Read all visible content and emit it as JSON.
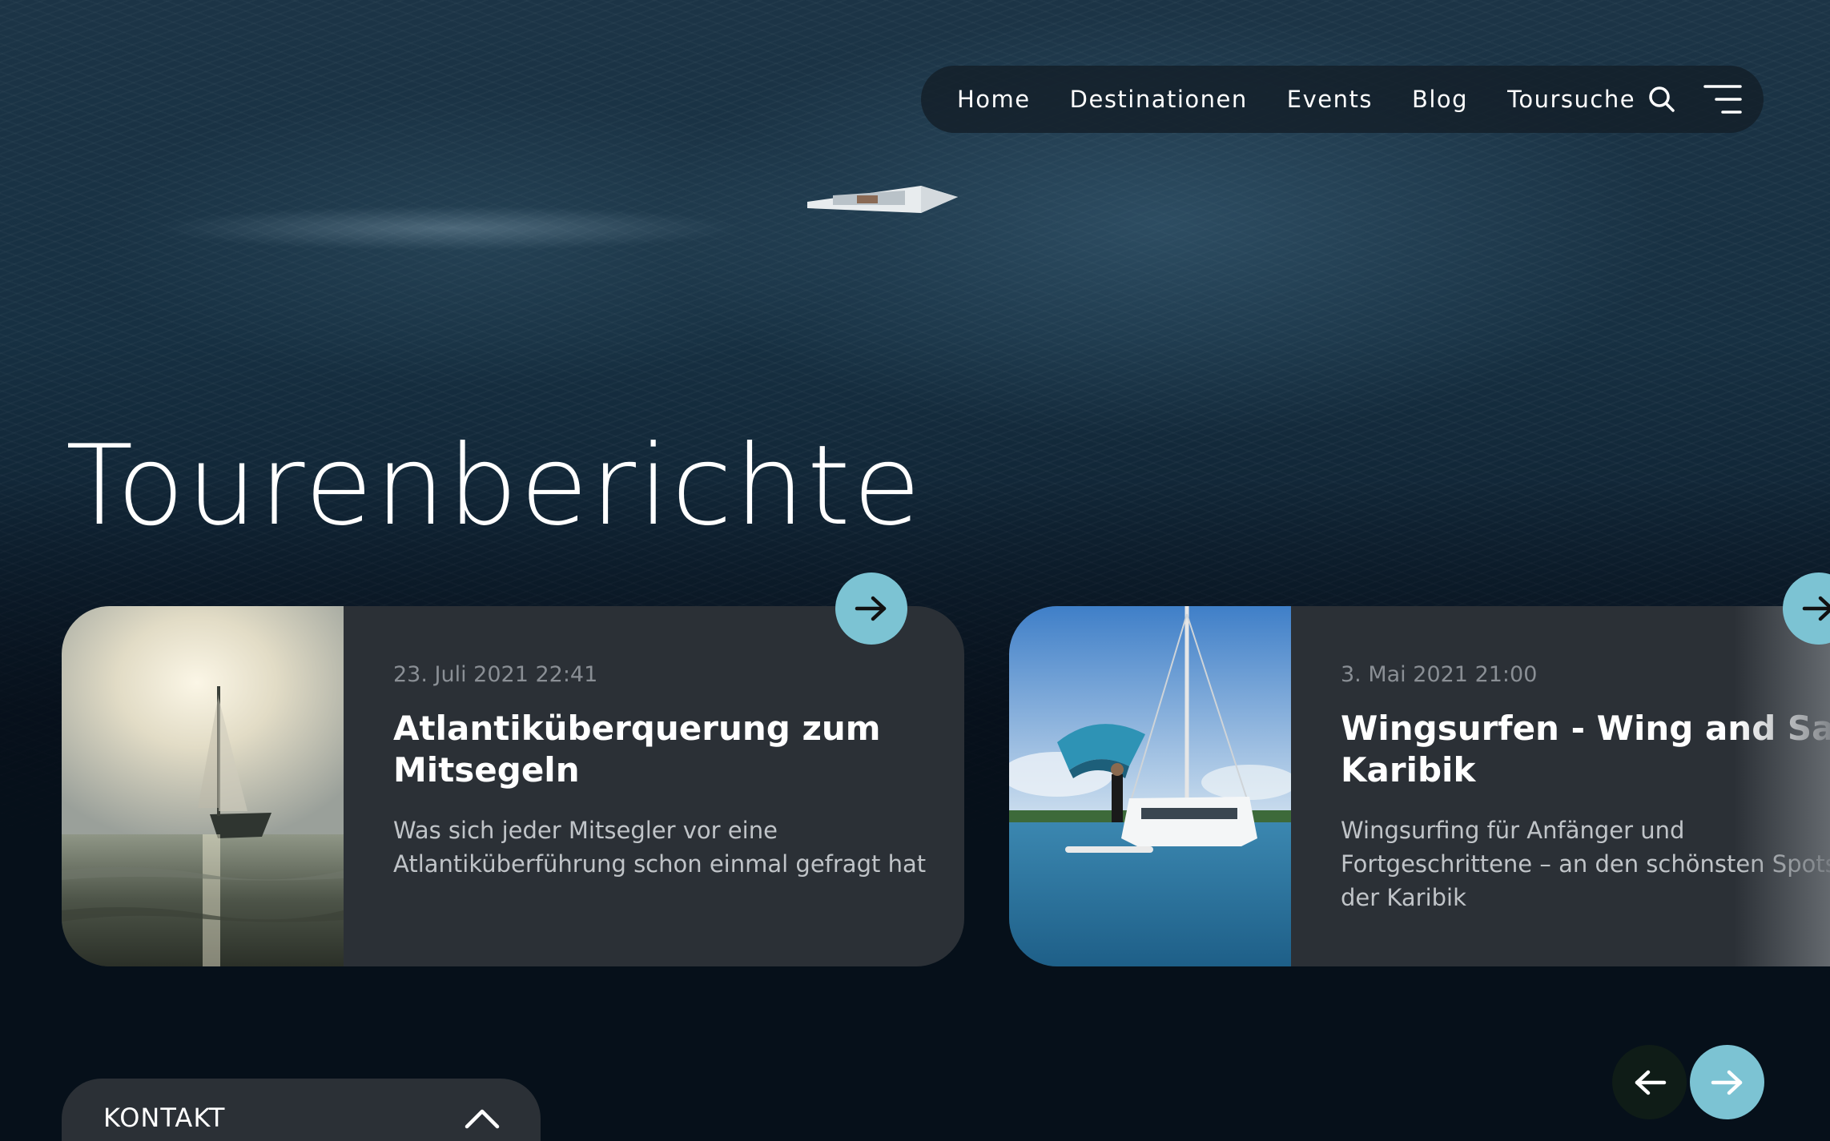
{
  "nav": {
    "items": [
      "Home",
      "Destinationen",
      "Events",
      "Blog",
      "Toursuche"
    ],
    "search_icon": "search-icon",
    "menu_icon": "menu-icon"
  },
  "page": {
    "title": "Tourenberichte"
  },
  "cards": [
    {
      "date": "23. Juli 2021 22:41",
      "title": "Atlantiküberquerung zum Mitsegeln",
      "excerpt": "Was sich jeder Mitsegler vor eine Atlantiküberführung schon einmal gefragt hat",
      "image": "sailboat-at-sunset-image"
    },
    {
      "date": "3. Mai 2021 21:00",
      "title": "Wingsurfen - Wing and Sail Karibik",
      "excerpt": "Wingsurfing für Anfänger und Fortgeschrittene – an den schönsten Spots der Karibik",
      "image": "wingsurfer-and-catamaran-image"
    }
  ],
  "slider": {
    "prev_icon": "arrow-left-icon",
    "next_icon": "arrow-right-icon"
  },
  "contact": {
    "label": "KONTAKT",
    "icon": "chevron-up-icon"
  },
  "colors": {
    "accent": "#7cc3d3",
    "card_bg": "#2b3036",
    "page_bg": "#07111b"
  }
}
